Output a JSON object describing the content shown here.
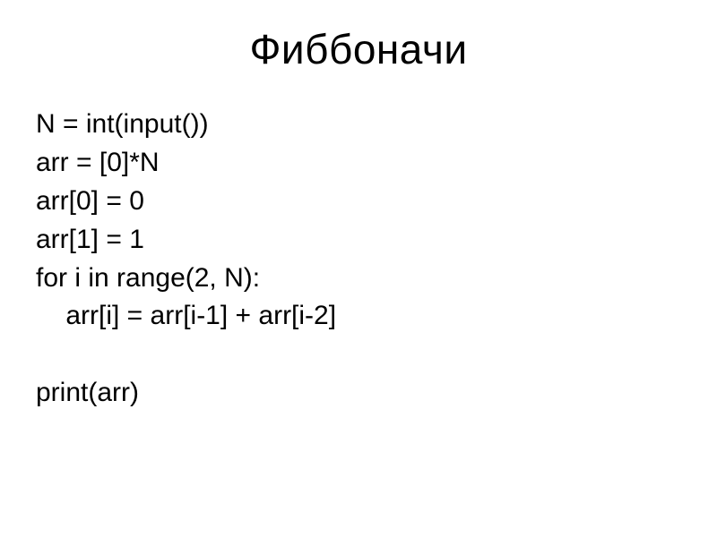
{
  "title": "Фиббоначи",
  "code": {
    "line1": "N = int(input())",
    "line2": "arr = [0]*N",
    "line3": "arr[0] = 0",
    "line4": "arr[1] = 1",
    "line5": "for i in range(2, N):",
    "line6": "    arr[i] = arr[i-1] + arr[i-2]",
    "line7": "print(arr)"
  }
}
